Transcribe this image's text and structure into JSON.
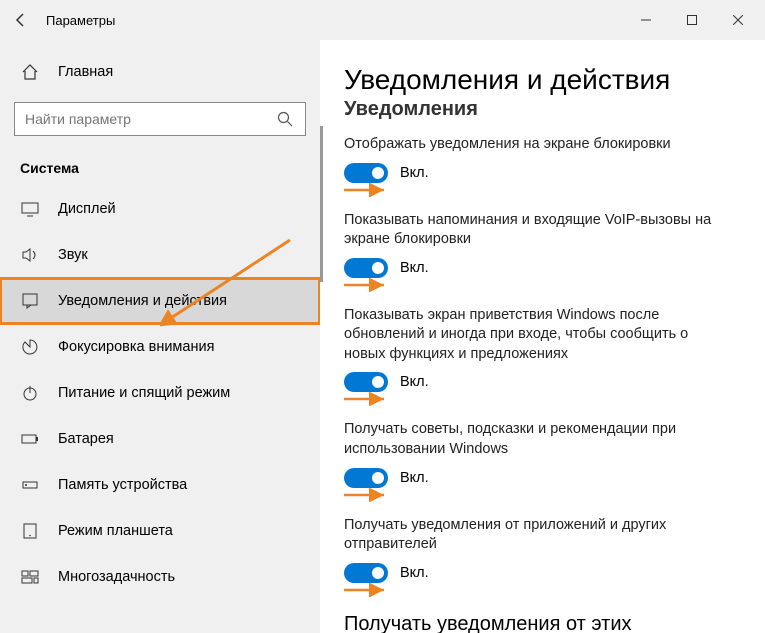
{
  "window": {
    "title": "Параметры",
    "minimize": "−",
    "maximize": "☐",
    "close": "✕"
  },
  "sidebar": {
    "home_label": "Главная",
    "search_placeholder": "Найти параметр",
    "category_label": "Система",
    "items": [
      {
        "label": "Дисплей"
      },
      {
        "label": "Звук"
      },
      {
        "label": "Уведомления и действия"
      },
      {
        "label": "Фокусировка внимания"
      },
      {
        "label": "Питание и спящий режим"
      },
      {
        "label": "Батарея"
      },
      {
        "label": "Память устройства"
      },
      {
        "label": "Режим планшета"
      },
      {
        "label": "Многозадачность"
      }
    ]
  },
  "content": {
    "heading": "Уведомления и действия",
    "subheading_cut": "Уведомления",
    "settings": [
      {
        "text": "Отображать уведомления на экране блокировки",
        "toggle_label": "Вкл.",
        "on": true
      },
      {
        "text": "Показывать напоминания и входящие VoIP-вызовы на экране блокировки",
        "toggle_label": "Вкл.",
        "on": true
      },
      {
        "text": "Показывать экран приветствия Windows после обновлений и иногда при входе, чтобы сообщить о новых функциях и предложениях",
        "toggle_label": "Вкл.",
        "on": true
      },
      {
        "text": "Получать советы, подсказки и рекомендации при использовании Windows",
        "toggle_label": "Вкл.",
        "on": true
      },
      {
        "text": "Получать уведомления от приложений и других отправителей",
        "toggle_label": "Вкл.",
        "on": true
      }
    ],
    "section2": "Получать уведомления от этих"
  },
  "colors": {
    "accent": "#0078d4",
    "highlight": "#ed8424"
  }
}
